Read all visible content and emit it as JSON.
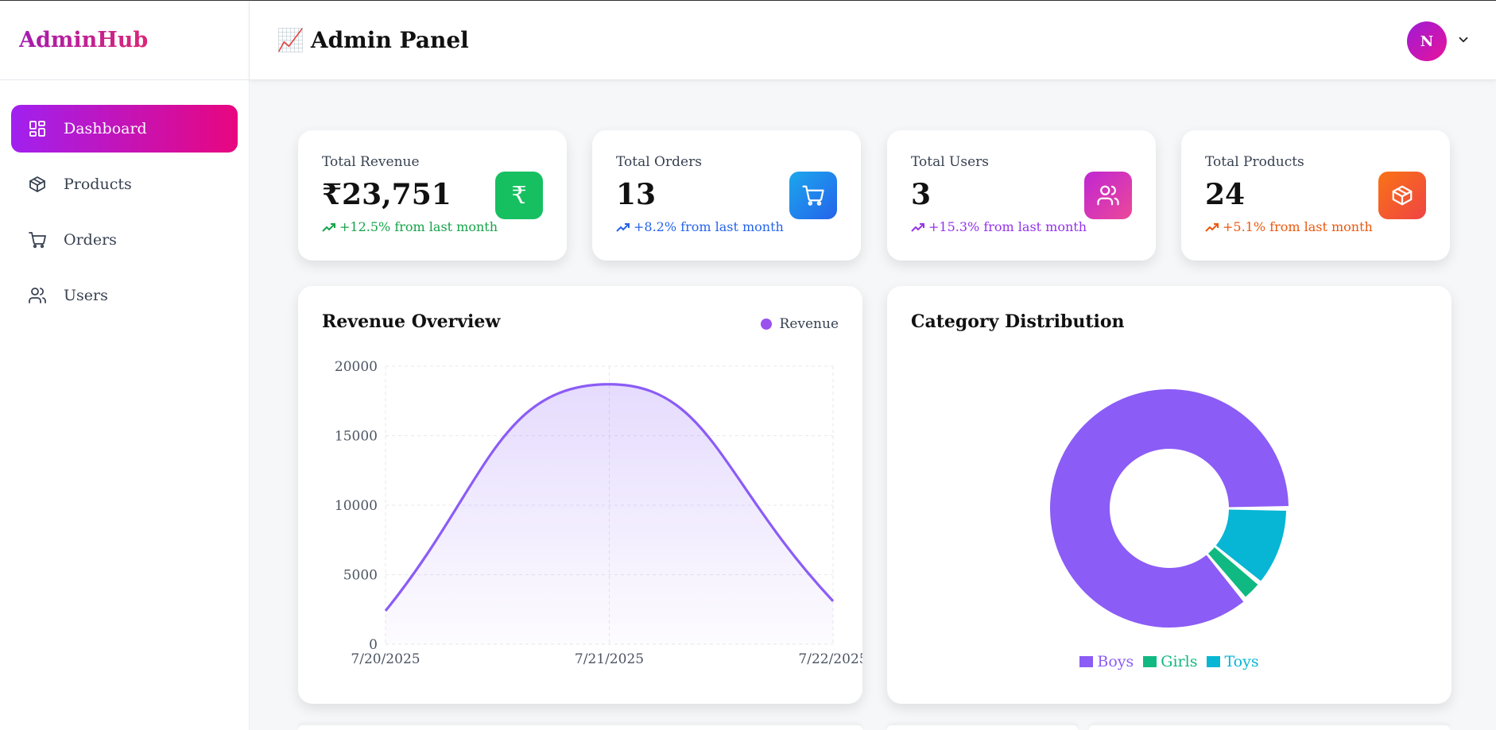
{
  "sidebar": {
    "brand": "AdminHub",
    "items": [
      {
        "label": "Dashboard",
        "icon": "dashboard-icon",
        "active": true
      },
      {
        "label": "Products",
        "icon": "box-icon",
        "active": false
      },
      {
        "label": "Orders",
        "icon": "cart-icon",
        "active": false
      },
      {
        "label": "Users",
        "icon": "users-icon",
        "active": false
      }
    ]
  },
  "header": {
    "icon": "📈",
    "title": "Admin Panel",
    "avatar_initial": "N"
  },
  "stats": [
    {
      "label": "Total Revenue",
      "value": "₹23,751",
      "trend": "+12.5% from last month",
      "color": "#16a34a",
      "badge": "#16c060",
      "icon": "rupee-icon"
    },
    {
      "label": "Total Orders",
      "value": "13",
      "trend": "+8.2% from last month",
      "color": "#2563eb",
      "badge": "#1e88f5",
      "icon": "cart-icon"
    },
    {
      "label": "Total Users",
      "value": "3",
      "trend": "+15.3% from last month",
      "color": "#9333ea",
      "badge": "#d946ef",
      "icon": "users-icon"
    },
    {
      "label": "Total Products",
      "value": "24",
      "trend": "+5.1% from last month",
      "color": "#ea580c",
      "badge": "#f97316",
      "icon": "box-icon"
    }
  ],
  "revenue": {
    "title": "Revenue Overview",
    "legend": "Revenue"
  },
  "category": {
    "title": "Category Distribution"
  },
  "chart_data": [
    {
      "type": "area",
      "title": "Revenue Overview",
      "x": [
        "7/20/2025",
        "7/21/2025",
        "7/22/2025"
      ],
      "series": [
        {
          "name": "Revenue",
          "values": [
            2400,
            18700,
            3100
          ],
          "color": "#8b5cf6"
        }
      ],
      "ylim": [
        0,
        20000
      ],
      "yticks": [
        0,
        5000,
        10000,
        15000,
        20000
      ],
      "grid": true,
      "legend": "top-right"
    },
    {
      "type": "pie",
      "title": "Category Distribution",
      "categories": [
        "Boys",
        "Girls",
        "Toys"
      ],
      "values": [
        86,
        3,
        11
      ],
      "colors": [
        "#8b5cf6",
        "#10b981",
        "#06b6d4"
      ],
      "legend": "bottom"
    }
  ]
}
